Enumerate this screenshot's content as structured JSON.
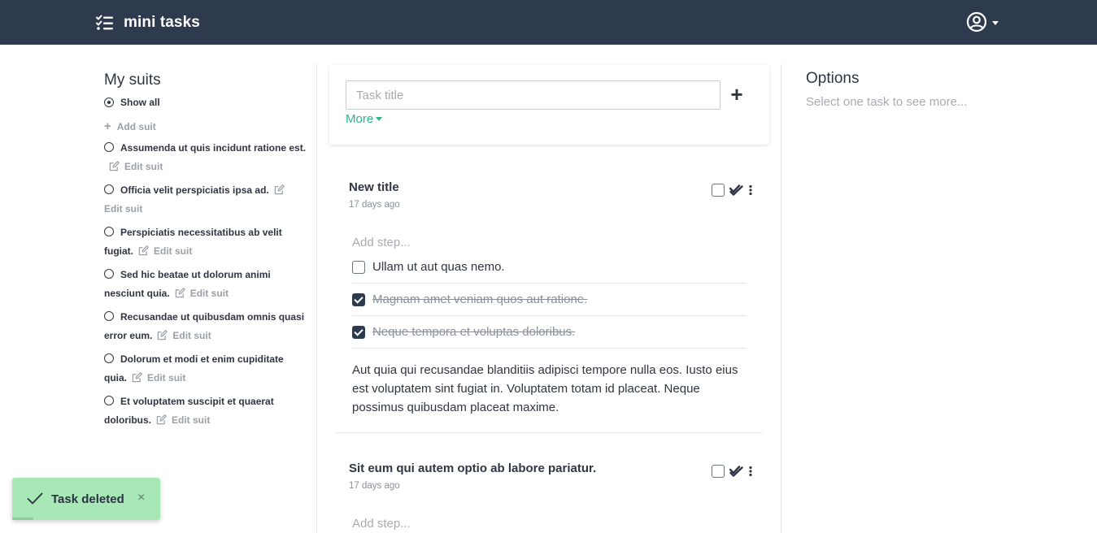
{
  "app": {
    "name": "mini tasks"
  },
  "header": {
    "brand_icon": "tasks-list-icon",
    "user_icon": "user-circle-icon"
  },
  "sidebar": {
    "title": "My suits",
    "show_all_label": "Show all",
    "add_suit_label": "Add suit",
    "edit_label": "Edit suit",
    "suits": [
      {
        "name": "Assumenda ut quis incidunt ratione est."
      },
      {
        "name": "Officia velit perspiciatis ipsa ad."
      },
      {
        "name": "Perspiciatis necessitatibus ab velit fugiat."
      },
      {
        "name": "Sed hic beatae ut dolorum animi nesciunt quia."
      },
      {
        "name": "Recusandae ut quibusdam omnis quasi error eum."
      },
      {
        "name": "Dolorum et modi et enim cupiditate quia."
      },
      {
        "name": "Et voluptatem suscipit et quaerat doloribus."
      }
    ]
  },
  "new_task": {
    "placeholder": "Task title",
    "add_label": "+",
    "more_label": "More"
  },
  "tasks": [
    {
      "title": "New title",
      "date": "17 days ago",
      "add_step_placeholder": "Add step...",
      "steps": [
        {
          "text": "Ullam ut aut quas nemo.",
          "done": false
        },
        {
          "text": "Magnam amet veniam quos aut ratione.",
          "done": true
        },
        {
          "text": "Neque tempora et voluptas doloribus.",
          "done": true
        }
      ],
      "description": "Aut quia qui recusandae blanditiis adipisci tempore nulla eos. Iusto eius est voluptatem sint fugiat in. Voluptatem totam id placeat. Neque possimus quibusdam placeat maxime."
    },
    {
      "title": "Sit eum qui autem optio ab labore pariatur.",
      "date": "17 days ago",
      "add_step_placeholder": "Add step..."
    }
  ],
  "options": {
    "title": "Options",
    "hint": "Select one task to see more..."
  },
  "toast": {
    "message": "Task deleted",
    "close_label": "×",
    "icon": "check-icon",
    "color": "#a7e8b6"
  },
  "colors": {
    "navbar": "#2e3a4d",
    "accent": "#2bb58b",
    "toast": "#a7e8b6"
  }
}
